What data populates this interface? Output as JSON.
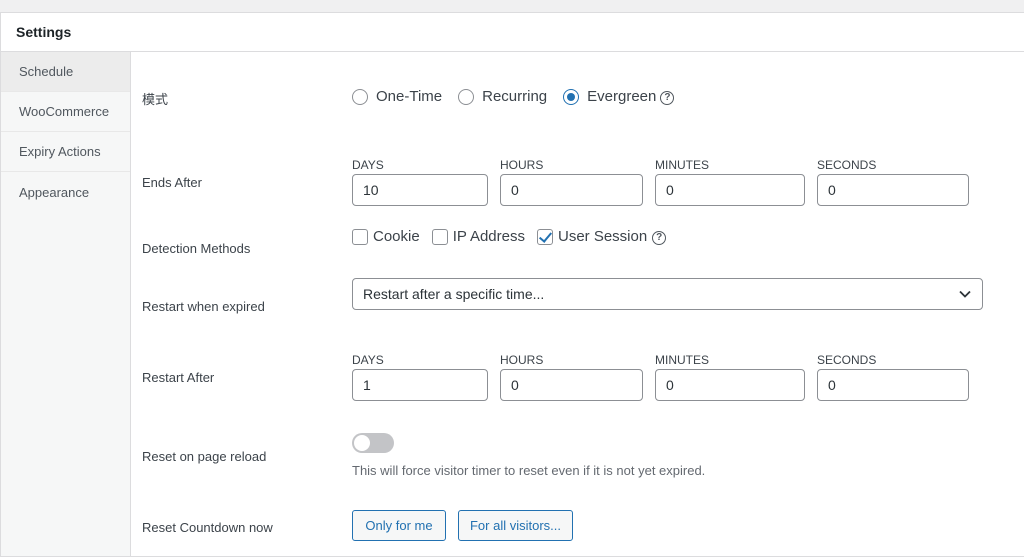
{
  "panel": {
    "title": "Settings"
  },
  "sidebar": {
    "items": [
      {
        "label": "Schedule",
        "active": true
      },
      {
        "label": "WooCommerce"
      },
      {
        "label": "Expiry Actions"
      },
      {
        "label": "Appearance"
      }
    ]
  },
  "mode": {
    "label": "模式",
    "options": [
      "One-Time",
      "Recurring",
      "Evergreen"
    ],
    "selected": "Evergreen",
    "help": "?"
  },
  "ends_after": {
    "label": "Ends After",
    "units": [
      "DAYS",
      "HOURS",
      "MINUTES",
      "SECONDS"
    ],
    "values": [
      "10",
      "0",
      "0",
      "0"
    ]
  },
  "detection": {
    "label": "Detection Methods",
    "options": [
      {
        "label": "Cookie",
        "checked": false
      },
      {
        "label": "IP Address",
        "checked": false
      },
      {
        "label": "User Session",
        "checked": true
      }
    ],
    "help": "?"
  },
  "restart_when_expired": {
    "label": "Restart when expired",
    "value": "Restart after a specific time..."
  },
  "restart_after": {
    "label": "Restart After",
    "units": [
      "DAYS",
      "HOURS",
      "MINUTES",
      "SECONDS"
    ],
    "values": [
      "1",
      "0",
      "0",
      "0"
    ]
  },
  "reset_reload": {
    "label": "Reset on page reload",
    "enabled": false,
    "description": "This will force visitor timer to reset even if it is not yet expired."
  },
  "reset_now": {
    "label": "Reset Countdown now",
    "buttons": [
      "Only for me",
      "For all visitors..."
    ]
  },
  "colors": {
    "accent": "#2271b1",
    "border": "#8c8f94",
    "sidebar_bg": "#f6f7f7"
  }
}
